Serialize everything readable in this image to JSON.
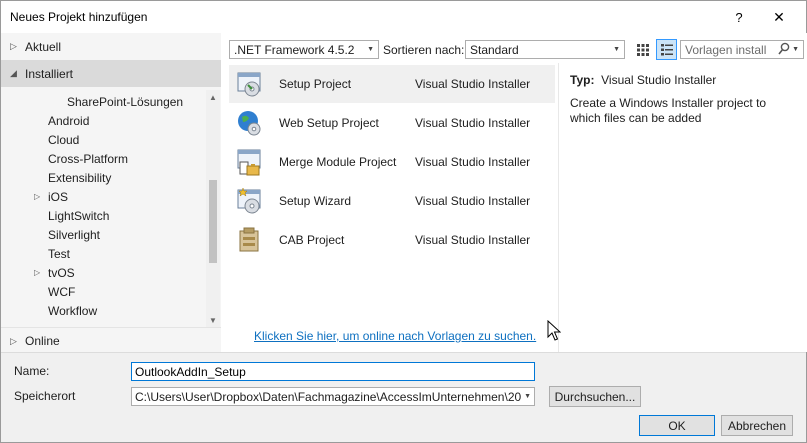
{
  "window": {
    "title": "Neues Projekt hinzufügen",
    "help_glyph": "?",
    "close_glyph": "✕"
  },
  "left_panel": {
    "aktuell": "Aktuell",
    "installiert": "Installiert",
    "online": "Online",
    "tree_items": [
      {
        "label": "SharePoint-Lösungen",
        "expandable": false
      },
      {
        "label": "Android",
        "expandable": false
      },
      {
        "label": "Cloud",
        "expandable": false
      },
      {
        "label": "Cross-Platform",
        "expandable": false
      },
      {
        "label": "Extensibility",
        "expandable": false
      },
      {
        "label": "iOS",
        "expandable": true
      },
      {
        "label": "LightSwitch",
        "expandable": false
      },
      {
        "label": "Silverlight",
        "expandable": false
      },
      {
        "label": "Test",
        "expandable": false
      },
      {
        "label": "tvOS",
        "expandable": true
      },
      {
        "label": "WCF",
        "expandable": false
      },
      {
        "label": "Workflow",
        "expandable": false
      }
    ]
  },
  "toolbar": {
    "framework": ".NET Framework 4.5.2",
    "sort_label": "Sortieren nach:",
    "sort_value": "Standard",
    "search_placeholder": "Vorlagen install"
  },
  "templates": [
    {
      "name": "Setup Project",
      "category": "Visual Studio Installer",
      "icon": "setup-project-icon",
      "selected": true
    },
    {
      "name": "Web Setup Project",
      "category": "Visual Studio Installer",
      "icon": "web-setup-project-icon",
      "selected": false
    },
    {
      "name": "Merge Module Project",
      "category": "Visual Studio Installer",
      "icon": "merge-module-project-icon",
      "selected": false
    },
    {
      "name": "Setup Wizard",
      "category": "Visual Studio Installer",
      "icon": "setup-wizard-icon",
      "selected": false
    },
    {
      "name": "CAB Project",
      "category": "Visual Studio Installer",
      "icon": "cab-project-icon",
      "selected": false
    }
  ],
  "online_link": "Klicken Sie hier, um online nach Vorlagen zu suchen.",
  "details": {
    "type_label": "Typ:",
    "type_value": "Visual Studio Installer",
    "description": "Create a Windows Installer project to which files can be added"
  },
  "bottom": {
    "name_label": "Name:",
    "name_value": "OutlookAddIn_Setup",
    "location_label": "Speicherort",
    "location_value": "C:\\Users\\User\\Dropbox\\Daten\\Fachmagazine\\AccessImUnternehmen\\20",
    "browse_label": "Durchsuchen...",
    "ok_label": "OK",
    "cancel_label": "Abbrechen"
  },
  "colors": {
    "link": "#0e70c0",
    "selection": "#dadada",
    "focus": "#0078d7"
  }
}
